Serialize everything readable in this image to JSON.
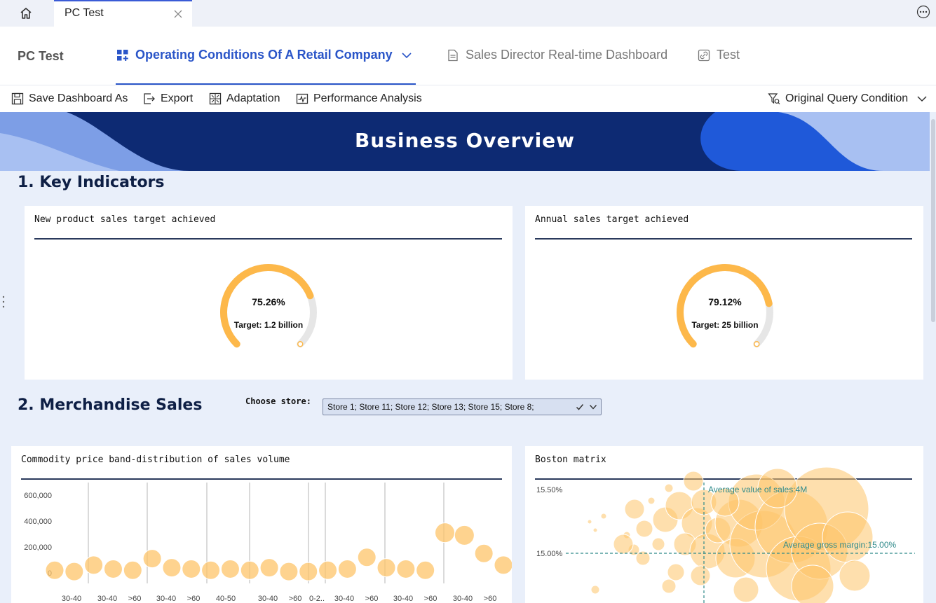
{
  "browser": {
    "tab_title": "PC Test"
  },
  "nav": {
    "brand": "PC Test",
    "items": [
      {
        "label": "Operating Conditions Of A Retail Company",
        "active": true,
        "icon": "dashboard-grid-icon"
      },
      {
        "label": "Sales Director Real-time Dashboard",
        "active": false,
        "icon": "document-icon"
      },
      {
        "label": "Test",
        "active": false,
        "icon": "link-icon"
      }
    ]
  },
  "toolbar": {
    "save_label": "Save Dashboard As",
    "export_label": "Export",
    "adaptation_label": "Adaptation",
    "performance_label": "Performance Analysis",
    "query_label": "Original Query Condition"
  },
  "banner": {
    "title": "Business Overview"
  },
  "sections": {
    "key_indicators": "1. Key Indicators",
    "merchandise_sales": "2. Merchandise Sales"
  },
  "kpis": [
    {
      "title": "New product sales target achieved",
      "value": "75.26%",
      "fraction": 0.7526,
      "target": "Target:  1.2 billion"
    },
    {
      "title": "Annual sales target achieved",
      "value": "79.12%",
      "fraction": 0.7912,
      "target": "Target:  25 billion"
    }
  ],
  "store_filter": {
    "label": "Choose store:",
    "value": "Store 1; Store 11; Store 12; Store 13; Store 15; Store 8;"
  },
  "colors": {
    "accent": "#2a55c8",
    "gauge": "#fdb84a",
    "gauge_track": "#e6e6e6",
    "bubble": "#fdc46a",
    "teal": "#2f8a8a",
    "banner": "#0d2a73"
  },
  "chart_data": [
    {
      "type": "scatter",
      "title": "Commodity price band-distribution of sales volume",
      "ylim": [
        0,
        600000
      ],
      "y_ticks": [
        "600,000",
        "400,000",
        "200,000",
        "0"
      ],
      "x_tick_labels": [
        "30-40",
        "30-40",
        ">60",
        "30-40",
        ">60",
        "40-50",
        "30-40",
        ">60",
        "0-2..",
        "30-40",
        ">60",
        "30-40",
        ">60",
        "30-40",
        ">60"
      ],
      "series": [
        {
          "values": [
            20000,
            10000,
            60000,
            30000,
            20000,
            110000,
            40000,
            30000,
            20000,
            30000,
            20000,
            40000,
            10000,
            10000,
            20000,
            30000,
            120000,
            40000,
            30000,
            20000,
            310000,
            290000,
            150000,
            60000
          ]
        }
      ]
    },
    {
      "type": "scatter",
      "title": "Boston matrix",
      "y_ticks": [
        "15.50%",
        "15.00%"
      ],
      "annotations": [
        "Average value of sales:4M",
        "Average gross margin:15.00%"
      ]
    }
  ]
}
